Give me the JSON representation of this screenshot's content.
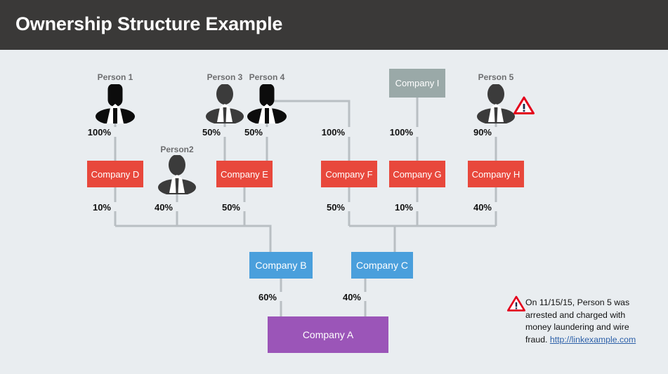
{
  "header": {
    "title": "Ownership Structure Example"
  },
  "colors": {
    "header_bg": "#3a3938",
    "canvas_bg": "#e9edf0",
    "company_red": "#e8483c",
    "company_blue": "#4a9fdc",
    "company_purple": "#9b55b8",
    "company_gray": "#9aa9a8",
    "connector": "#b9bfc3",
    "label_gray": "#6d6e70",
    "link_blue": "#2b5fa8",
    "warning_red": "#e3001b"
  },
  "persons": [
    {
      "id": "person1",
      "label": "Person 1",
      "gender": "female"
    },
    {
      "id": "person2",
      "label": "Person2",
      "gender": "male"
    },
    {
      "id": "person3",
      "label": "Person 3",
      "gender": "male"
    },
    {
      "id": "person4",
      "label": "Person 4",
      "gender": "female"
    },
    {
      "id": "person5",
      "label": "Person 5",
      "gender": "male",
      "flagged": true
    }
  ],
  "companies": [
    {
      "id": "companyA",
      "label": "Company A",
      "color": "purple"
    },
    {
      "id": "companyB",
      "label": "Company B",
      "color": "blue"
    },
    {
      "id": "companyC",
      "label": "Company C",
      "color": "blue"
    },
    {
      "id": "companyD",
      "label": "Company D",
      "color": "red"
    },
    {
      "id": "companyE",
      "label": "Company E",
      "color": "red"
    },
    {
      "id": "companyF",
      "label": "Company F",
      "color": "red"
    },
    {
      "id": "companyG",
      "label": "Company G",
      "color": "red"
    },
    {
      "id": "companyH",
      "label": "Company H",
      "color": "red"
    },
    {
      "id": "companyI",
      "label": "Company I",
      "color": "gray"
    }
  ],
  "ownership": [
    {
      "from": "person1",
      "to": "companyD",
      "percent": "100%"
    },
    {
      "from": "person3",
      "to": "companyE",
      "percent": "50%"
    },
    {
      "from": "person4",
      "to": "companyE",
      "percent": "50%"
    },
    {
      "from": "person4",
      "to": "companyF",
      "percent": "100%"
    },
    {
      "from": "companyI",
      "to": "companyG",
      "percent": "100%"
    },
    {
      "from": "person5",
      "to": "companyH",
      "percent": "90%"
    },
    {
      "from": "companyD",
      "to": "companyB",
      "percent": "10%"
    },
    {
      "from": "person2",
      "to": "companyB",
      "percent": "40%"
    },
    {
      "from": "companyE",
      "to": "companyB",
      "percent": "50%"
    },
    {
      "from": "companyF",
      "to": "companyC",
      "percent": "50%"
    },
    {
      "from": "companyG",
      "to": "companyC",
      "percent": "10%"
    },
    {
      "from": "companyH",
      "to": "companyC",
      "percent": "40%"
    },
    {
      "from": "companyB",
      "to": "companyA",
      "percent": "60%"
    },
    {
      "from": "companyC",
      "to": "companyA",
      "percent": "40%"
    }
  ],
  "percent_labels": {
    "p1_d": "100%",
    "p3_e": "50%",
    "p4_e": "50%",
    "p4_f": "100%",
    "i_g": "100%",
    "p5_h": "90%",
    "d_b": "10%",
    "p2_b": "40%",
    "e_b": "50%",
    "f_c": "50%",
    "g_c": "10%",
    "h_c": "40%",
    "b_a": "60%",
    "c_a": "40%"
  },
  "annotation": {
    "text": "On 11/15/15, Person 5 was arrested and charged with money laundering and wire fraud. ",
    "link_text": "http://linkexample.com",
    "icon": "warning-triangle-icon"
  }
}
